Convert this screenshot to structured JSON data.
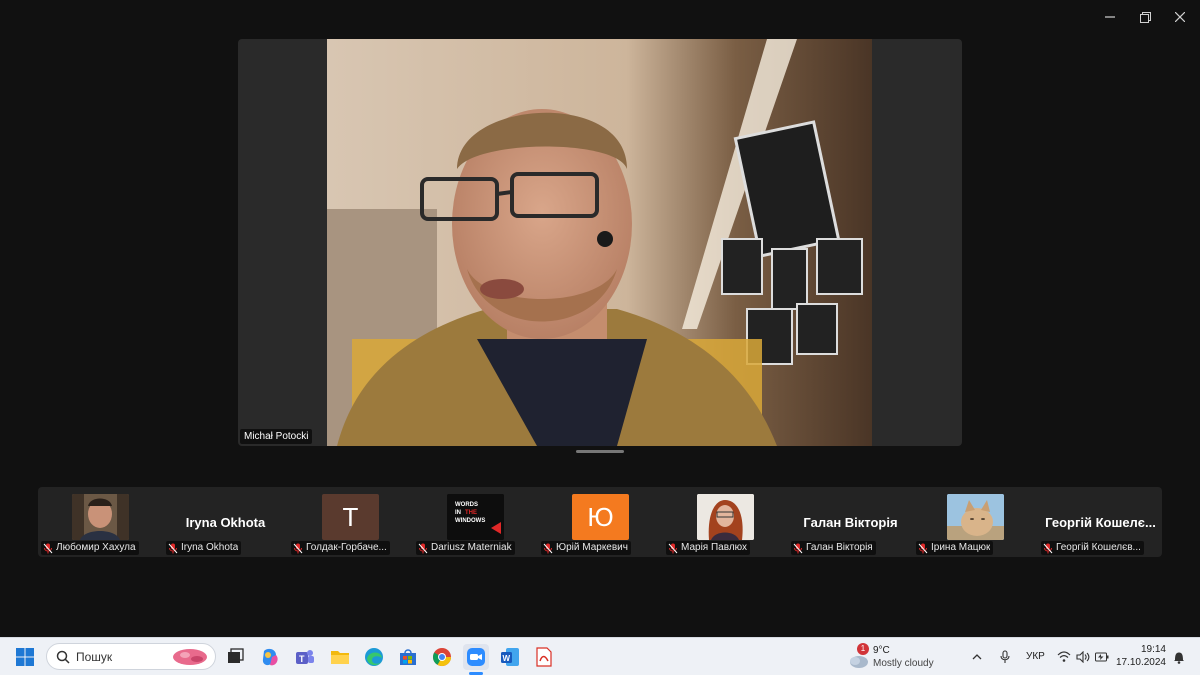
{
  "window": {
    "controls": [
      "minimize",
      "restore",
      "close"
    ]
  },
  "main_speaker": {
    "name": "Michał Potocki"
  },
  "participants": [
    {
      "display": "photo",
      "label": "Любомир Хахула"
    },
    {
      "display": "name",
      "big_name": "Iryna Okhota",
      "label": "Iryna Okhota"
    },
    {
      "display": "letter",
      "letter": "Т",
      "bg": "#5a3a2e",
      "label": "Голдак-Горбаче..."
    },
    {
      "display": "logo",
      "logo_text": "WORDS\nIN\nTHE\nWINDOWS",
      "label": "Dariusz Materniak"
    },
    {
      "display": "letter",
      "letter": "Ю",
      "bg": "#f47a1f",
      "label": "Юрій Маркевич"
    },
    {
      "display": "photo2",
      "label": "Марія Павлюх"
    },
    {
      "display": "name",
      "big_name": "Галан Вікторія",
      "label": "Галан Вікторія"
    },
    {
      "display": "photo3",
      "label": "Ірина Мацюк"
    },
    {
      "display": "name",
      "big_name": "Георгій Кошелє...",
      "label": "Георгій Кошелєв..."
    }
  ],
  "taskbar": {
    "search_placeholder": "Пошук",
    "weather": {
      "badge": "1",
      "temp": "9°C",
      "desc": "Mostly cloudy"
    },
    "language": "УКР",
    "time": "19:14",
    "date": "17.10.2024"
  },
  "colors": {
    "accent": "#2d8cff",
    "muted_mic": "#e02828"
  }
}
